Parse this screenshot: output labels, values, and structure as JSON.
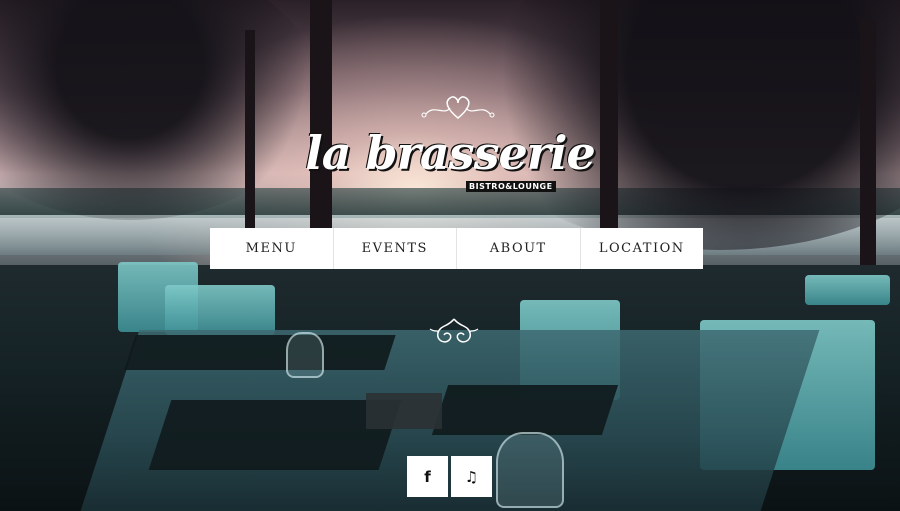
{
  "brand": {
    "name": "la brasserie",
    "tagline": "BISTRO&LOUNGE"
  },
  "nav": {
    "items": [
      {
        "label": "MENU"
      },
      {
        "label": "EVENTS"
      },
      {
        "label": "ABOUT"
      },
      {
        "label": "LOCATION"
      }
    ]
  },
  "social": {
    "items": [
      {
        "icon": "facebook-icon",
        "glyph": "f"
      },
      {
        "icon": "music-note-icon",
        "glyph": "♫"
      }
    ]
  },
  "colors": {
    "nav_background": "#ffffff",
    "nav_text": "#222222"
  }
}
